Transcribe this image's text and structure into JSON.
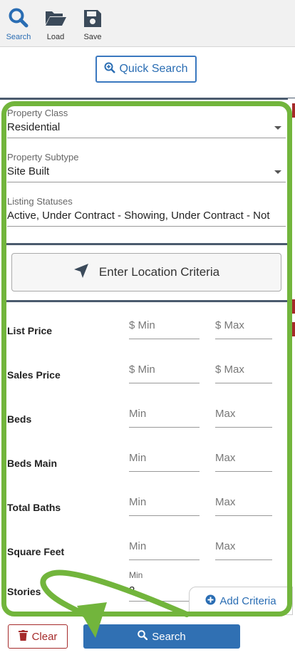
{
  "toolbar": {
    "search_label": "Search",
    "load_label": "Load",
    "save_label": "Save"
  },
  "quick_search": {
    "label": "Quick Search"
  },
  "form": {
    "property_class": {
      "label": "Property Class",
      "value": "Residential"
    },
    "property_subtype": {
      "label": "Property Subtype",
      "value": "Site Built"
    },
    "listing_statuses": {
      "label": "Listing Statuses",
      "value": "Active, Under Contract - Showing, Under Contract - Not"
    },
    "location_button": "Enter Location Criteria",
    "rows": [
      {
        "label": "List Price",
        "min": "$  Min",
        "max": "$  Max"
      },
      {
        "label": "Sales Price",
        "min": "$  Min",
        "max": "$  Max"
      },
      {
        "label": "Beds",
        "min": "Min",
        "max": "Max"
      },
      {
        "label": "Beds Main",
        "min": "Min",
        "max": "Max"
      },
      {
        "label": "Total Baths",
        "min": "Min",
        "max": "Max"
      },
      {
        "label": "Square Feet",
        "min": "Min",
        "max": "Max"
      }
    ],
    "stories": {
      "label": "Stories",
      "min_label": "Min",
      "value": "2"
    },
    "add_criteria": "Add Criteria"
  },
  "actions": {
    "clear_label": "Clear",
    "search_label": "Search"
  },
  "colors": {
    "accent_blue": "#2a6db3",
    "clear_red": "#a52a2a",
    "annotation_green": "#72b53c",
    "divider": "#4b5b6e"
  },
  "icons": [
    "search-icon",
    "folder-open-icon",
    "floppy-disk-icon",
    "zoom-plus-icon",
    "location-arrow-icon",
    "plus-circle-icon",
    "trash-icon"
  ]
}
